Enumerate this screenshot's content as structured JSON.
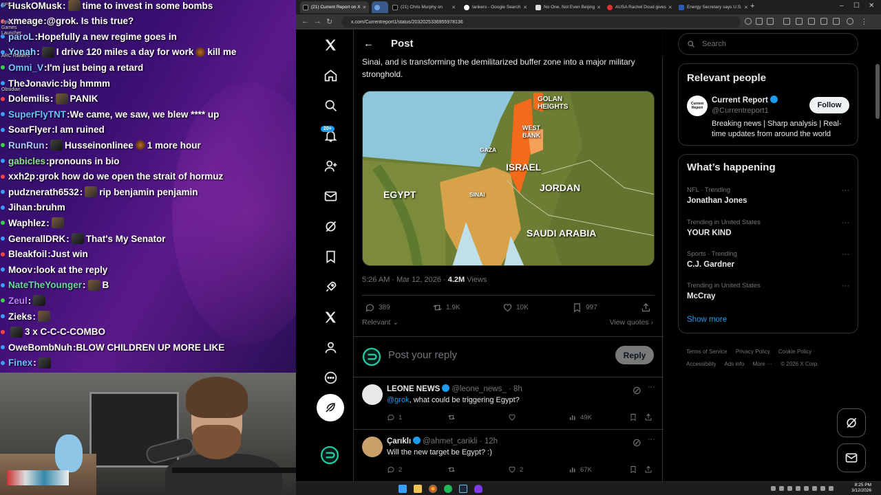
{
  "stream_chat": {
    "lines": [
      {
        "name": "HuskOMusk",
        "msg": "time to invest in some bombs",
        "color": "#ffffff"
      },
      {
        "name": "xmeage",
        "msg": "@grok. Is this true?",
        "color": "#ffffff"
      },
      {
        "name": "paroL",
        "msg": "Hopefully a new regime goes in",
        "color": "#9ecbff"
      },
      {
        "name": "Yonah",
        "msg": "I drive 120 miles a day for work",
        "extra": "kill me",
        "color": "#7fd4ff"
      },
      {
        "name": "Omni_V",
        "msg": "I'm just being a retard",
        "color": "#7fc3ff"
      },
      {
        "name": "TheJonavic",
        "msg": "big hmmm",
        "color": "#ffffff"
      },
      {
        "name": "Dolemilis",
        "msg": "PANIK",
        "color": "#ffffff"
      },
      {
        "name": "SuperFlyTNT",
        "msg": "We came, we saw, we blew **** up",
        "color": "#66c2ff"
      },
      {
        "name": "SoarFlyer",
        "msg": "I am ruined",
        "color": "#ffffff"
      },
      {
        "name": "RunRun",
        "msg": "Husseinonlinee",
        "extra": "1 more hour",
        "color": "#a8c8ff"
      },
      {
        "name": "gabicles",
        "msg": "pronouns in bio",
        "color": "#8fe08f"
      },
      {
        "name": "xxh2p",
        "msg": "grok how do we open the strait of hormuz",
        "color": "#ffffff"
      },
      {
        "name": "pudznerath6532",
        "msg": "rip benjamin penjamin",
        "color": "#ffffff"
      },
      {
        "name": "Jihan",
        "msg": "bruhm",
        "color": "#ffffff"
      },
      {
        "name": "Waphlez",
        "msg": "",
        "color": "#ffffff"
      },
      {
        "name": "GenerallDRK",
        "msg": "That's My Senator",
        "color": "#ffffff"
      },
      {
        "name": "Bleakfoil",
        "msg": "Just win",
        "color": "#ffffff"
      },
      {
        "name": "Moov",
        "msg": "look at the reply",
        "color": "#ffffff"
      },
      {
        "name": "NateTheYounger",
        "msg": "B",
        "color": "#66d9a0"
      },
      {
        "name": "Zeul",
        "msg": "",
        "color": "#c27dff"
      },
      {
        "name": "Zieks",
        "msg": "",
        "color": "#ffffff"
      },
      {
        "name": "",
        "msg": "3 x C-C-C-COMBO",
        "color": "#ffffff"
      },
      {
        "name": "OweBombNuh",
        "msg": "BLOW CHILDREN UP MORE LIKE",
        "color": "#ffffff"
      },
      {
        "name": "Finex",
        "msg": "",
        "color": "#66c2ff"
      }
    ],
    "side_labels": [
      "EPIC",
      "Epic Games Launcher",
      "ARC Raiders",
      "Obsidian"
    ]
  },
  "browser": {
    "tabs": [
      {
        "label": "(21) Current Report on X",
        "active": true
      },
      {
        "label": "",
        "active": false
      },
      {
        "label": "(21) Chris Murphy on",
        "active": false
      },
      {
        "label": "tankers - Google Search",
        "active": false
      },
      {
        "label": "No One, Not Even Beijing",
        "active": false
      },
      {
        "label": "AUSA Rachel Doud gives",
        "active": false
      },
      {
        "label": "Energy Secretary says U.S.",
        "active": false
      }
    ],
    "url": "x.com/Currentreport1/status/2032025336955978136"
  },
  "x": {
    "header_title": "Post",
    "notifications_badge": "20+",
    "post": {
      "text": "Sinai, and is transforming the demilitarized buffer zone into a major military stronghold.",
      "map_labels": {
        "golan": "GOLAN HEIGHTS",
        "westbank": "WEST BANK",
        "gaza": "GAZA",
        "israel": "ISRAEL",
        "jordan": "JORDAN",
        "egypt": "EGYPT",
        "sinai": "SINAI",
        "saudi": "SAUDI ARABIA"
      },
      "time": "5:26 AM · Mar 12, 2026 ·",
      "views_count": "4.2M",
      "views_label": "Views",
      "replies": "389",
      "reposts": "1.9K",
      "likes": "10K",
      "bookmarks": "997",
      "sort_label": "Relevant",
      "view_quotes": "View quotes"
    },
    "reply_placeholder": "Post your reply",
    "reply_button": "Reply",
    "replies": [
      {
        "name": "LEONE NEWS",
        "handle": "@leone_news_ · 8h",
        "mention": "@grok",
        "text": ", what could be triggering Egypt?",
        "replies": "1",
        "reposts": "",
        "likes": "",
        "views": "49K",
        "avatar_color": "#e8e8e8"
      },
      {
        "name": "Çarıklı",
        "handle": "@ahmet_carikli · 12h",
        "mention": "",
        "text": "Will the new target be Egypt? :)",
        "replies": "2",
        "reposts": "",
        "likes": "2",
        "views": "67K",
        "avatar_color": "#c9a06a"
      }
    ],
    "sidebar": {
      "search_placeholder": "Search",
      "relevant_title": "Relevant people",
      "person": {
        "avatar_text": "Current Report",
        "name": "Current Report",
        "handle": "@Currentreport1",
        "bio": "Breaking news | Sharp analysis | Real-time updates from around the world",
        "follow": "Follow"
      },
      "happening_title": "What’s happening",
      "trends": [
        {
          "context": "NFL · Trending",
          "title": "Jonathan Jones"
        },
        {
          "context": "Trending in United States",
          "title": "YOUR KIND"
        },
        {
          "context": "Sports · Trending",
          "title": "C.J. Gardner"
        },
        {
          "context": "Trending in United States",
          "title": "McCray"
        }
      ],
      "show_more": "Show more",
      "footer": [
        "Terms of Service",
        "Privacy Policy",
        "Cookie Policy",
        "Accessibility",
        "Ads info",
        "More ···",
        "© 2026 X Corp."
      ]
    }
  },
  "taskbar": {
    "time": "8:25 PM",
    "date": "3/12/2026"
  },
  "colors": {
    "accent": "#1d9bf0",
    "israel": "#f26a1b",
    "background": "#000000"
  }
}
